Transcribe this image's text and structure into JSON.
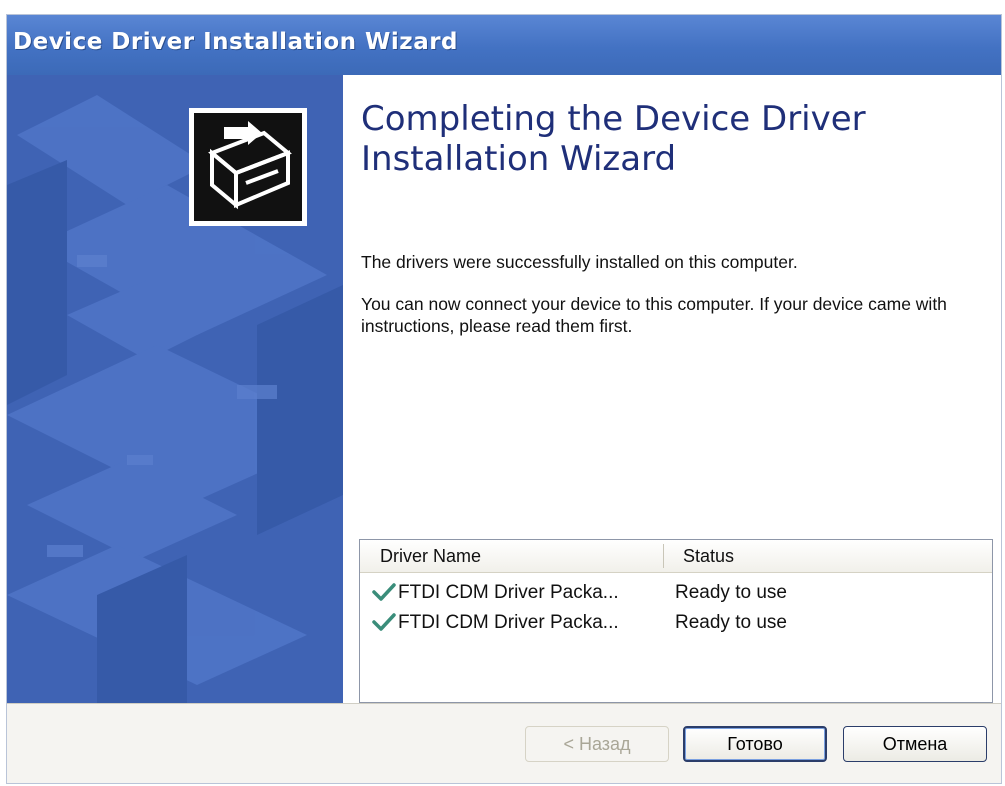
{
  "window": {
    "title": "Device Driver Installation Wizard"
  },
  "content": {
    "heading_line1": "Completing the Device Driver",
    "heading_line2": "Installation Wizard",
    "message1": "The drivers were successfully installed on this computer.",
    "message2": "You can now connect your device to this computer. If your device came with instructions, please read them first."
  },
  "driver_table": {
    "columns": [
      "Driver Name",
      "Status"
    ],
    "rows": [
      {
        "name": "FTDI CDM Driver Packa...",
        "status": "Ready to use",
        "icon": "checkmark-icon"
      },
      {
        "name": "FTDI CDM Driver Packa...",
        "status": "Ready to use",
        "icon": "checkmark-icon"
      }
    ]
  },
  "buttons": {
    "back": "< Назад",
    "finish": "Готово",
    "cancel": "Отмена"
  },
  "colors": {
    "titlebar": "#4372c3",
    "side_panel": "#3f63b4",
    "heading": "#1f2f79",
    "checkmark": "#3a8d7a"
  }
}
